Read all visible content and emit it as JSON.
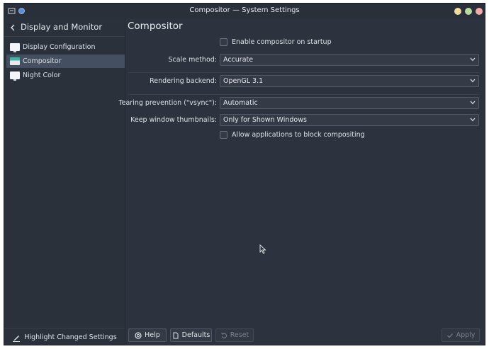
{
  "window": {
    "title": "Compositor — System Settings"
  },
  "sidebar": {
    "title": "Display and Monitor",
    "items": [
      {
        "label": "Display Configuration",
        "icon": "monitor-icon",
        "active": false
      },
      {
        "label": "Compositor",
        "icon": "compositor-icon",
        "active": true
      },
      {
        "label": "Night Color",
        "icon": "monitor-icon",
        "active": false
      }
    ],
    "footer_label": "Highlight Changed Settings"
  },
  "main": {
    "title": "Compositor",
    "enable_on_startup": {
      "label": "Enable compositor on startup",
      "checked": false
    },
    "scale_method": {
      "label": "Scale method:",
      "value": "Accurate"
    },
    "rendering_backend": {
      "label": "Rendering backend:",
      "value": "OpenGL 3.1"
    },
    "tearing_prevention": {
      "label": "Tearing prevention (\"vsync\"):",
      "value": "Automatic"
    },
    "keep_thumbnails": {
      "label": "Keep window thumbnails:",
      "value": "Only for Shown Windows"
    },
    "allow_block": {
      "label": "Allow applications to block compositing",
      "checked": false
    }
  },
  "buttons": {
    "help": "Help",
    "defaults": "Defaults",
    "reset": "Reset",
    "apply": "Apply"
  },
  "colors": {
    "background": "#2d333e",
    "sidebar": "#2b313b",
    "selection": "#445062"
  }
}
